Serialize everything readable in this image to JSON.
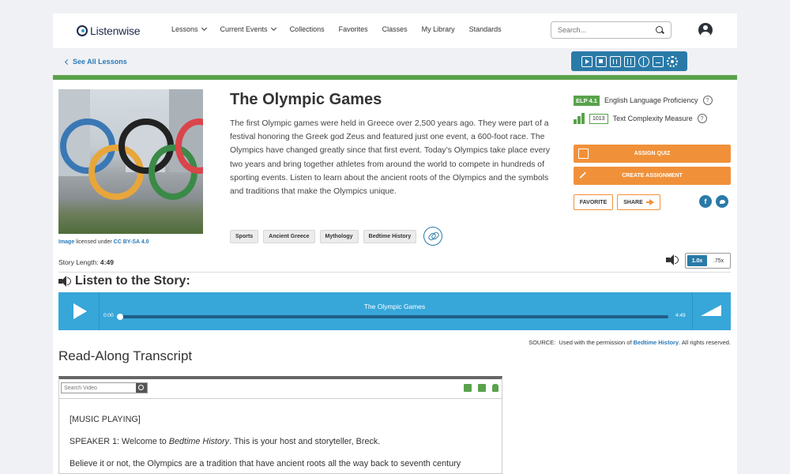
{
  "header": {
    "logo_text": "Listenwise",
    "nav": [
      {
        "label": "Lessons",
        "dropdown": true
      },
      {
        "label": "Current Events",
        "dropdown": true
      },
      {
        "label": "Collections",
        "dropdown": false
      },
      {
        "label": "Favorites",
        "dropdown": false
      },
      {
        "label": "Classes",
        "dropdown": false
      },
      {
        "label": "My Library",
        "dropdown": false
      },
      {
        "label": "Standards",
        "dropdown": false
      }
    ],
    "search_placeholder": "Search..."
  },
  "subbar": {
    "back_label": "See All Lessons",
    "toolbar_icons": [
      "play-icon",
      "stop-icon",
      "pause-icon",
      "book-icon",
      "globe-icon",
      "picture-icon",
      "gear-icon"
    ]
  },
  "lesson": {
    "title": "The Olympic Games",
    "description": "The first Olympic games were held in Greece over 2,500 years ago. They were part of a festival honoring the Greek god Zeus and featured just one event, a 600-foot race. The Olympics have changed greatly since that first event. Today’s Olympics take place every two years and bring together athletes from around the world to compete in hundreds of sporting events. Listen to learn about the ancient roots of the Olympics and the symbols and traditions that make the Olympics unique.",
    "tags": [
      "Sports",
      "Ancient Greece",
      "Mythology",
      "Bedtime History"
    ],
    "image_credit_prefix": "Image",
    "image_credit_middle": " licensed under ",
    "image_credit_license": "CC BY-SA 4.0",
    "story_length_label": "Story Length: ",
    "story_length_value": "4:49"
  },
  "side": {
    "elp_badge": "ELP 4.1",
    "elp_label": "English Language Proficiency",
    "lexile_value": "1013",
    "lexile_label": "Text Complexity Measure",
    "assign_quiz": "ASSIGN QUIZ",
    "create_assignment": "CREATE ASSIGNMENT",
    "favorite": "FAVORITE",
    "share": "SHARE",
    "facebook": "f"
  },
  "speed": {
    "options": [
      "1.0x",
      ".75x"
    ],
    "selected": "1.0x"
  },
  "listen_heading": "Listen to the Story:",
  "player": {
    "title": "The Olympic Games",
    "current_time": "0:00",
    "duration": "4:49",
    "progress": 0
  },
  "source": {
    "label": "SOURCE:",
    "text_before": "Used with the permission of ",
    "link": "Bedtime History",
    "text_after": ". All rights reserved."
  },
  "transcript": {
    "heading": "Read-Along Transcript",
    "search_placeholder": "Search Video",
    "lines": [
      {
        "text": "[MUSIC PLAYING]"
      },
      {
        "before": "SPEAKER 1: Welcome to ",
        "italic": "Bedtime History",
        "after": ". This is your host and storyteller, Breck."
      },
      {
        "text": "Believe it or not, the Olympics are a tradition that have ancient roots all the way back to seventh century"
      }
    ]
  },
  "colors": {
    "brand_blue": "#2a7aa8",
    "player_blue": "#37a6d9",
    "green": "#5aa24c",
    "orange": "#f0913a"
  }
}
